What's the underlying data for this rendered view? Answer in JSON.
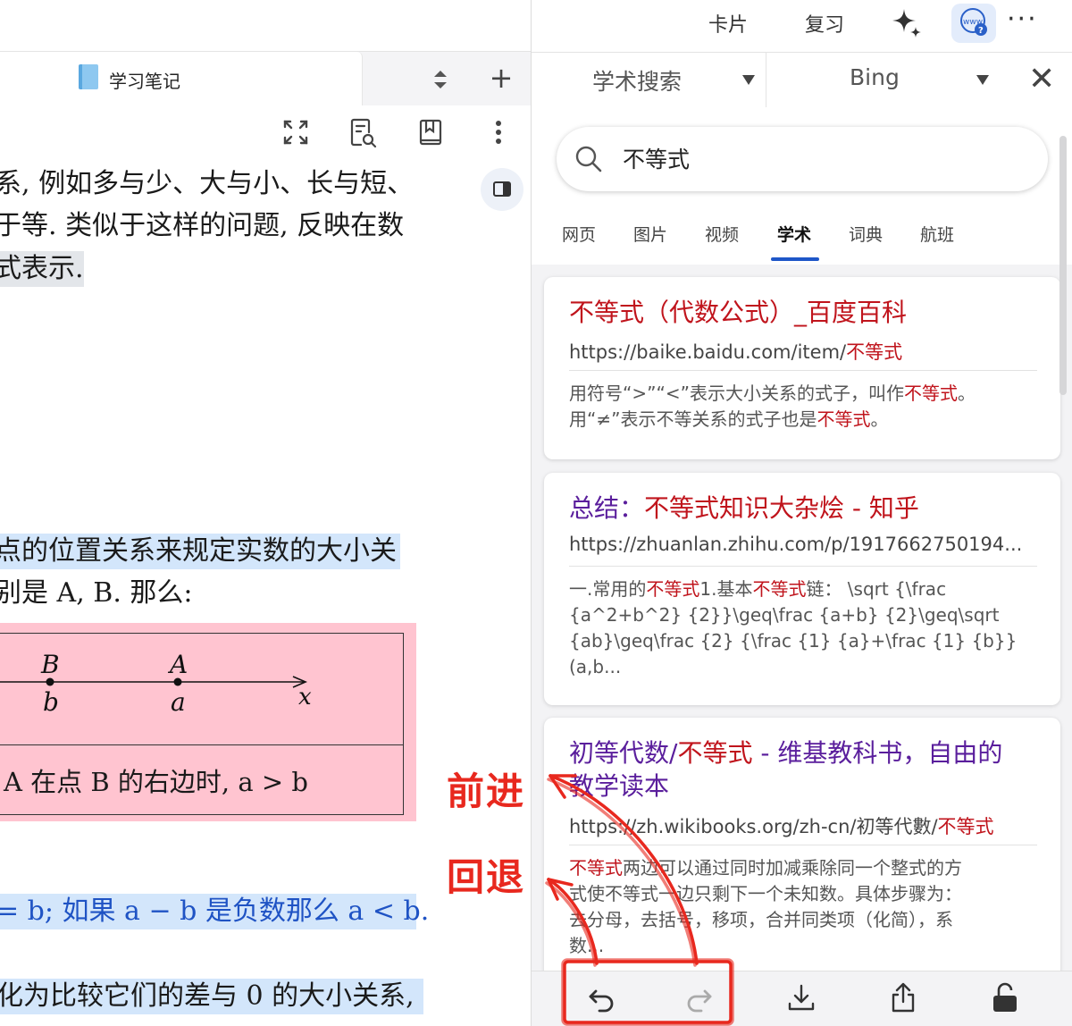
{
  "left": {
    "tab_label": "学习笔记",
    "paragraph_lines": [
      "系, 例如多与少、大与小、长与短、",
      "于等. 类似于这样的问题, 反映在数",
      "式表示."
    ],
    "lines2": [
      "点的位置关系来规定实数的大小关",
      "别是 A, B. 那么:"
    ],
    "numberline": {
      "labels_upper": [
        "B",
        "A"
      ],
      "labels_lower": [
        "b",
        "a"
      ],
      "axis": "x"
    },
    "box_text": "A 在点 B 的右边时, a > b",
    "line_blue": "= b; 如果 a − b 是负数那么 a < b.",
    "line_last": "化为比较它们的差与 0 的大小关系,"
  },
  "right": {
    "top_links": [
      "卡片",
      "复习"
    ],
    "engine1": "学术搜索",
    "engine2": "Bing",
    "search_value": "不等式",
    "search_tabs": [
      "网页",
      "图片",
      "视频",
      "学术",
      "词典",
      "航班"
    ],
    "active_tab": "学术",
    "results": [
      {
        "title_parts": [
          "不等式（代数公式）_百度百科"
        ],
        "url_prefix": "https://baike.baidu.com/item/",
        "url_hl": "不等式",
        "snippet_lines": [
          [
            "用符号“>”“<”表示大小关系的式子，叫作",
            "不等式",
            "。"
          ],
          [
            "用“≠”表示不等关系的式子也是",
            "不等式",
            "。"
          ]
        ]
      },
      {
        "title_a": "总结：",
        "title_b": "不等式知识大杂烩 - 知乎",
        "url": "https://zhuanlan.zhihu.com/p/1917662750194...",
        "snippet_line1": [
          "一.常用的",
          "不等式",
          "1.基本",
          "不等式",
          "链：  \\sqrt {\\frac"
        ],
        "snippet_rest": [
          "{a^2+b^2} {2}}\\geq\\frac {a+b} {2}\\geq\\sqrt",
          "{ab}\\geq\\frac {2} {\\frac {1} {a}+\\frac {1} {b}}",
          "(a,b..."
        ]
      },
      {
        "title_line1_a": "初等代数/",
        "title_line1_b": "不等式",
        "title_line1_c": " - 维基教科书，自由的",
        "title_line2": "教学读本",
        "url_prefix": "https://zh.wikibooks.org/zh-cn/初等代數/",
        "url_hl": "不等式",
        "snippet_line1": [
          "不等式",
          "两边可以通过同时加减乘除同一个整式的方"
        ],
        "snippet_rest": [
          "式使不等式一边只剩下一个未知数。具体步骤为：",
          "去分母，去括号，移项，合并同类项（化简），系",
          "数..."
        ]
      }
    ]
  },
  "annotations": {
    "forward": "前进",
    "back": "回退"
  },
  "colors": {
    "link_red": "#c0141c",
    "link_purple": "#5a1e9c",
    "annotation_red": "#e8281e",
    "tab_accent": "#1e56c8",
    "highlight_pink": "#ffc4d0",
    "highlight_blue": "#d3e6fb"
  },
  "icons": [
    "book-icon",
    "sort-icon",
    "plus-icon",
    "fullscreen-icon",
    "page-search-icon",
    "bookmark-icon",
    "more-vertical-icon",
    "panel-toggle-icon",
    "sparkle-icon",
    "www-help-icon",
    "more-horizontal-icon",
    "close-icon",
    "search-icon",
    "back-icon",
    "forward-icon",
    "download-icon",
    "share-icon",
    "unlock-icon"
  ]
}
